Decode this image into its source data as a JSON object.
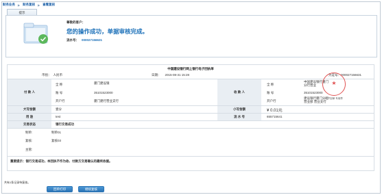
{
  "breadcrumb": [
    "财务业务",
    "财务复核",
    "查看复核"
  ],
  "tip_tab": "提示",
  "success": {
    "greeting": "尊敬的客户：",
    "message": "您的操作成功，单据审核完成。",
    "txn_label": "流水号：",
    "txn_number": "000027156631"
  },
  "receipt": {
    "title": "中国建设银行网上银行电子回执单",
    "currency_label": "币别：",
    "currency": "人民币",
    "date_label": "日期：",
    "date": "2015-08-31 15:28",
    "voucher_label": "凭证号：",
    "voucher": "000027156631",
    "payer": {
      "label": "付 款 人",
      "name_label": "全  称",
      "name": "厦门建设银",
      "account_label": "账  号",
      "account": "35101523000",
      "bank_label": "开户行",
      "bank": "厦门建行营业支行"
    },
    "payee": {
      "label": "收 款 人",
      "name_label": "全  称",
      "name": "中国建设银行厦门分行营业",
      "account_label": "账  号",
      "account": "35101523000",
      "bank_label": "开户行",
      "bank": "建设银行厦门分行营业部 营业支行"
    },
    "amount_words_label": "大写金额",
    "amount_words": "壹分",
    "amount_num_label": "小写金额",
    "amount_num": "¥ 0.01元",
    "purpose_label": "用    途",
    "purpose": "test",
    "serial_label": "流 水 号",
    "serial": "655715641",
    "status_label": "交易状态",
    "status": "银行交易成功",
    "checker_label": "制单:",
    "checker": "制单01",
    "reviewer_label": "复核:",
    "reviewer": "复核03",
    "approver_label": "主管:",
    "approver": "",
    "notice": "重要提示：银行交易成功，本回执不作为收、付款方交易确认的最终依据。",
    "stamp_text": "电子回单 专用章"
  },
  "footer_note": "共有1条记录待复核。",
  "buttons": {
    "print": "回单打印",
    "continue": "继续复核"
  }
}
